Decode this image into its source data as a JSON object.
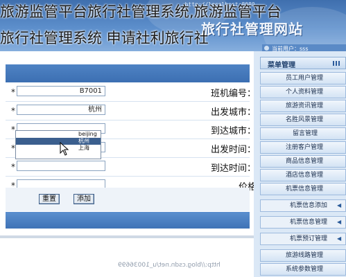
{
  "overlay": {
    "line1": "旅游监管平台旅行社管理系统,旅游监管平台",
    "line2": "旅行社管理系统 申请社利旅行社"
  },
  "banner": {
    "url_text": "http://localhost:8080 ...",
    "site_title": "旅行社管理网站",
    "user_text": "当前用户：sss"
  },
  "form": {
    "rows": [
      {
        "label": "班机编号：",
        "value": "B7001"
      },
      {
        "label": "出发城市：",
        "value": "杭州"
      },
      {
        "label": "到达城市：",
        "value": ""
      },
      {
        "label": "出发时间：",
        "value": ""
      },
      {
        "label": "到达时间：",
        "value": ""
      },
      {
        "label": "价格：",
        "value": ""
      }
    ],
    "required_mark": "*",
    "dropdown_options": [
      "beijing",
      "杭州",
      "上海"
    ],
    "dropdown_selected": "杭州",
    "buttons": {
      "add": "添加",
      "reset": "重置"
    }
  },
  "sidebar": {
    "header": "菜单管理",
    "items": [
      {
        "label": "员工用户管理",
        "sub": false
      },
      {
        "label": "个人资料管理",
        "sub": false
      },
      {
        "label": "旅游资讯管理",
        "sub": false
      },
      {
        "label": "名胜风景管理",
        "sub": false
      },
      {
        "label": "留言管理",
        "sub": false
      },
      {
        "label": "注册客户管理",
        "sub": false
      },
      {
        "label": "商品信息管理",
        "sub": false
      },
      {
        "label": "酒店信息管理",
        "sub": false
      },
      {
        "label": "机票信息管理",
        "sub": false
      },
      {
        "label": "机票信息添加",
        "sub": true
      },
      {
        "label": "机票信息管理",
        "sub": true
      },
      {
        "label": "机票预订管理",
        "sub": true
      },
      {
        "label": "旅游线路管理",
        "sub": false
      },
      {
        "label": "系统参数管理",
        "sub": false
      }
    ]
  },
  "watermark": "http://blog.csdn.net/u_10036699",
  "colors": {
    "banner": "#4a7bbd",
    "sidebar": "#dbe8f6",
    "header_bar": "#4f83c4"
  }
}
